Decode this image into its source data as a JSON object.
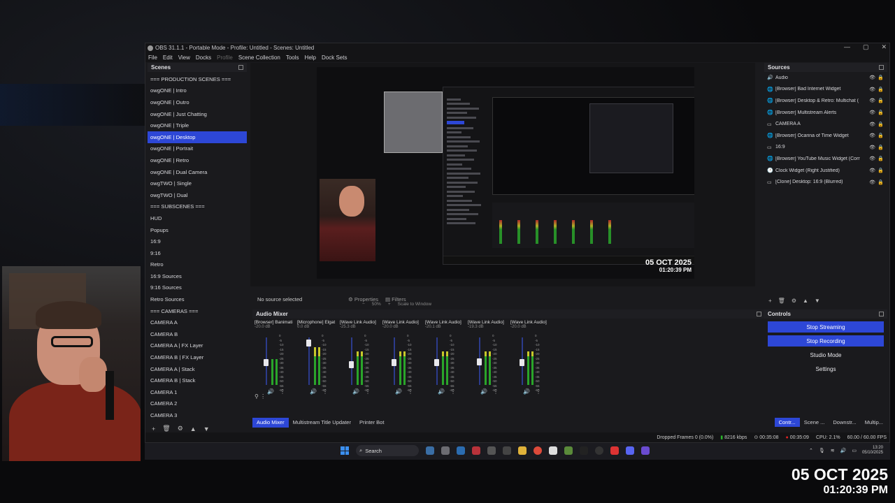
{
  "window": {
    "title": "OBS 31.1.1 - Portable Mode - Profile: Untitled - Scenes: Untitled",
    "controls": [
      "—",
      "▢",
      "✕"
    ]
  },
  "menu": [
    {
      "label": "File",
      "dim": false
    },
    {
      "label": "Edit",
      "dim": false
    },
    {
      "label": "View",
      "dim": false
    },
    {
      "label": "Docks",
      "dim": false
    },
    {
      "label": "Profile",
      "dim": true
    },
    {
      "label": "Scene Collection",
      "dim": false
    },
    {
      "label": "Tools",
      "dim": false
    },
    {
      "label": "Help",
      "dim": false
    },
    {
      "label": "Dock Sets",
      "dim": false
    }
  ],
  "scenes": {
    "title": "Scenes",
    "items": [
      "=== PRODUCTION SCENES ===",
      "owgONE | Intro",
      "owgONE | Outro",
      "owgONE | Just Chatting",
      "owgONE | Triple",
      "owgONE | Desktop",
      "owgONE | Portrait",
      "owgONE | Retro",
      "owgONE | Dual Camera",
      "owgTWO | Single",
      "owgTWO | Dual",
      "=== SUBSCENES ===",
      "HUD",
      "Popups",
      "16:9",
      "9:16",
      "Retro",
      "16:9 Sources",
      "9:16 Sources",
      "Retro Sources",
      "=== CAMERAS ===",
      "CAMERA A",
      "CAMERA B",
      "CAMERA A | FX Layer",
      "CAMERA B | FX Layer",
      "CAMERA A | Stack",
      "CAMERA B | Stack",
      "CAMERA 1",
      "CAMERA 2",
      "CAMERA 3"
    ],
    "selected_index": 5,
    "footer_icons": [
      "+",
      "🗑",
      "⚙",
      "▲",
      "▼"
    ]
  },
  "preview": {
    "date": "05 OCT 2025",
    "time": "01:20:39 PM",
    "zoom": "50%",
    "zoom_mode": "Scale to Window"
  },
  "props_row": {
    "no_source": "No source selected",
    "properties": "Properties",
    "filters": "Filters"
  },
  "mixer": {
    "title": "Audio Mixer",
    "channels": [
      {
        "name": "[Browser] Banimati",
        "db": "-20.0 dB",
        "fader": 0.5,
        "level": 0.55
      },
      {
        "name": "[Microphone] Elgat",
        "db": "0.0 dB",
        "fader": 0.95,
        "level": 0.8
      },
      {
        "name": "[Wave Link Audio]",
        "db": "-25.3 dB",
        "fader": 0.45,
        "level": 0.7
      },
      {
        "name": "[Wave Link Audio]",
        "db": "-20.0 dB",
        "fader": 0.5,
        "level": 0.7
      },
      {
        "name": "[Wave Link Audio]",
        "db": "-20.1 dB",
        "fader": 0.5,
        "level": 0.7
      },
      {
        "name": "[Wave Link Audio]",
        "db": "-19.3 dB",
        "fader": 0.52,
        "level": 0.7
      },
      {
        "name": "[Wave Link Audio]",
        "db": "-20.0 dB",
        "fader": 0.5,
        "level": 0.7
      }
    ],
    "scale": [
      "0",
      "-5",
      "-10",
      "-15",
      "-20",
      "-25",
      "-30",
      "-35",
      "-40",
      "-45",
      "-50",
      "-55",
      "-60"
    ]
  },
  "bottom_tabs": [
    {
      "label": "Audio Mixer",
      "active": true
    },
    {
      "label": "Multistream Title Updater",
      "active": false
    },
    {
      "label": "Printer Bot",
      "active": false
    }
  ],
  "sources": {
    "title": "Sources",
    "items": [
      {
        "icon": "🔊",
        "label": "Audio"
      },
      {
        "icon": "🌐",
        "label": "[Browser] Bad Internet Widget"
      },
      {
        "icon": "🌐",
        "label": "[Browser] Desktop & Retro: Multichat ("
      },
      {
        "icon": "🌐",
        "label": "[Browser] Multistream Alerts"
      },
      {
        "icon": "▭",
        "label": "CAMERA A"
      },
      {
        "icon": "🌐",
        "label": "[Browser] Ocarina of Time Widget"
      },
      {
        "icon": "▭",
        "label": "16:9"
      },
      {
        "icon": "🌐",
        "label": "[Browser] YouTube Music Widget (Corr"
      },
      {
        "icon": "🕐",
        "label": "Clock Widget (Right Justified)"
      },
      {
        "icon": "▭",
        "label": "[Clone] Desktop: 16:9 (Blurred)"
      }
    ],
    "footer_icons": [
      "+",
      "🗑",
      "⚙",
      "▲",
      "▼"
    ]
  },
  "controls": {
    "title": "Controls",
    "buttons": [
      {
        "label": "Stop Streaming",
        "active": true
      },
      {
        "label": "Stop Recording",
        "active": true
      },
      {
        "label": "Studio Mode",
        "active": false
      },
      {
        "label": "Settings",
        "active": false
      }
    ]
  },
  "dock_tabs": [
    {
      "label": "Contr...",
      "active": true
    },
    {
      "label": "Scene ...",
      "active": false
    },
    {
      "label": "Downstr...",
      "active": false
    },
    {
      "label": "Multip...",
      "active": false
    }
  ],
  "status": {
    "dropped": "Dropped Frames 0 (0.0%)",
    "bitrate": "8216 kbps",
    "stream_time": "00:35:08",
    "rec_time": "00:35:09",
    "cpu": "CPU: 2.1%",
    "fps": "60.00 / 60.00 FPS"
  },
  "taskbar": {
    "search": "Search",
    "clock_time": "13:20",
    "clock_date": "05/10/2025"
  },
  "overlay": {
    "date": "05 OCT 2025",
    "time": "01:20:39 PM"
  },
  "colors": {
    "accent": "#2d47d6",
    "panel": "#1a1a1d",
    "green": "#2bb52b"
  }
}
